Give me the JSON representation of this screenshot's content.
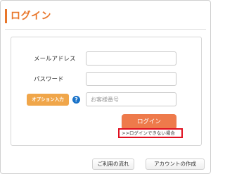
{
  "header": {
    "title": "ログイン"
  },
  "form": {
    "email_label": "メールアドレス",
    "password_label": "パスワード",
    "option_button_label": "オプション入力",
    "help_glyph": "?",
    "customer_number_placeholder": "お客様番号",
    "email_value": "",
    "password_value": "",
    "login_button_label": "ログイン",
    "forgot_link_label": ">>ログインできない場合"
  },
  "footer": {
    "guide_button_label": "ご利用の流れ",
    "create_account_button_label": "アカウントの作成"
  },
  "colors": {
    "accent": "#e8762a",
    "login_button": "#ee7a4b",
    "option_button": "#f0a64a",
    "help_icon": "#1a73c9",
    "highlight_box": "#e01020"
  }
}
